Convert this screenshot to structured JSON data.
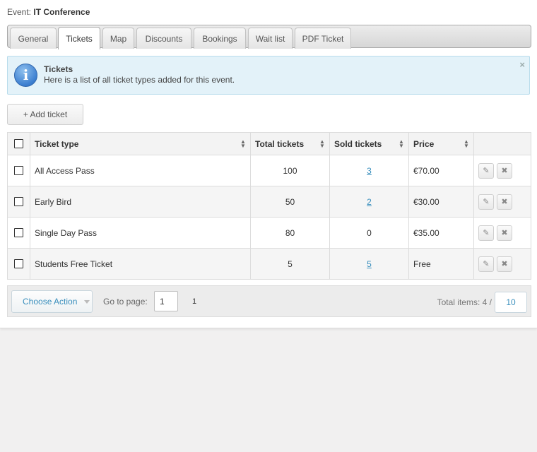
{
  "event": {
    "label": "Event:",
    "name": "IT Conference"
  },
  "tabs": [
    {
      "label": "General"
    },
    {
      "label": "Tickets",
      "active": true
    },
    {
      "label": "Map"
    },
    {
      "label": "Discounts"
    },
    {
      "label": "Bookings"
    },
    {
      "label": "Wait list"
    },
    {
      "label": "PDF Ticket"
    }
  ],
  "info": {
    "title": "Tickets",
    "text": "Here is a list of all ticket types added for this event.",
    "close_glyph": "×",
    "icon": "info-icon"
  },
  "toolbar": {
    "add_label": "+ Add ticket"
  },
  "table": {
    "headers": {
      "ticket_type": "Ticket type",
      "total_tickets": "Total tickets",
      "sold_tickets": "Sold tickets",
      "price": "Price"
    },
    "rows": [
      {
        "ticket_type": "All Access Pass",
        "total": "100",
        "sold": "3",
        "sold_link": true,
        "price": "€70.00"
      },
      {
        "ticket_type": "Early Bird",
        "total": "50",
        "sold": "2",
        "sold_link": true,
        "price": "€30.00"
      },
      {
        "ticket_type": "Single Day Pass",
        "total": "80",
        "sold": "0",
        "sold_link": false,
        "price": "€35.00"
      },
      {
        "ticket_type": "Students Free Ticket",
        "total": "5",
        "sold": "5",
        "sold_link": true,
        "price": "Free"
      }
    ],
    "row_actions": {
      "edit_icon": "pencil-icon",
      "delete_icon": "close-icon"
    }
  },
  "pager": {
    "action_label": "Choose Action",
    "goto_label": "Go to page:",
    "goto_value": "1",
    "pages": [
      "1"
    ],
    "total_label": "Total items: 4 /",
    "per_page": "10"
  },
  "colors": {
    "link": "#3a8fbd",
    "info_bg": "#e3f2f9",
    "info_border": "#b9dcec"
  }
}
